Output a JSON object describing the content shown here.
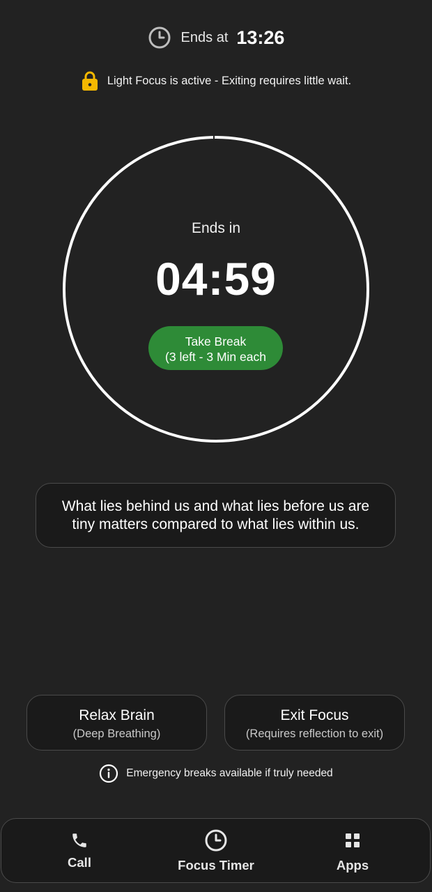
{
  "header": {
    "ends_at_label": "Ends at",
    "ends_at_time": "13:26",
    "focus_notice": "Light Focus is active - Exiting requires little wait."
  },
  "timer": {
    "ends_in_label": "Ends in",
    "countdown": "04:59",
    "take_break_line1": "Take Break",
    "take_break_line2": "(3 left - 3 Min each"
  },
  "quote": {
    "text": "What lies behind us and what lies before us are tiny matters compared to what lies within us."
  },
  "actions": {
    "relax_title": "Relax Brain",
    "relax_sub": "(Deep Breathing)",
    "exit_title": "Exit Focus",
    "exit_sub": "(Requires reflection to exit)"
  },
  "emergency": {
    "text": "Emergency breaks available if truly needed"
  },
  "nav": {
    "call_label": "Call",
    "timer_label": "Focus Timer",
    "apps_label": "Apps"
  },
  "icons": {
    "clock": "clock-icon",
    "lock": "lock-icon",
    "info": "info-icon",
    "phone": "phone-icon",
    "timer": "timer-icon",
    "apps": "grid-icon"
  },
  "colors": {
    "background": "#222222",
    "card_background": "#1a1a1a",
    "break_button": "#2e8b37",
    "lock": "#f5b800",
    "ring": "#ffffff"
  }
}
